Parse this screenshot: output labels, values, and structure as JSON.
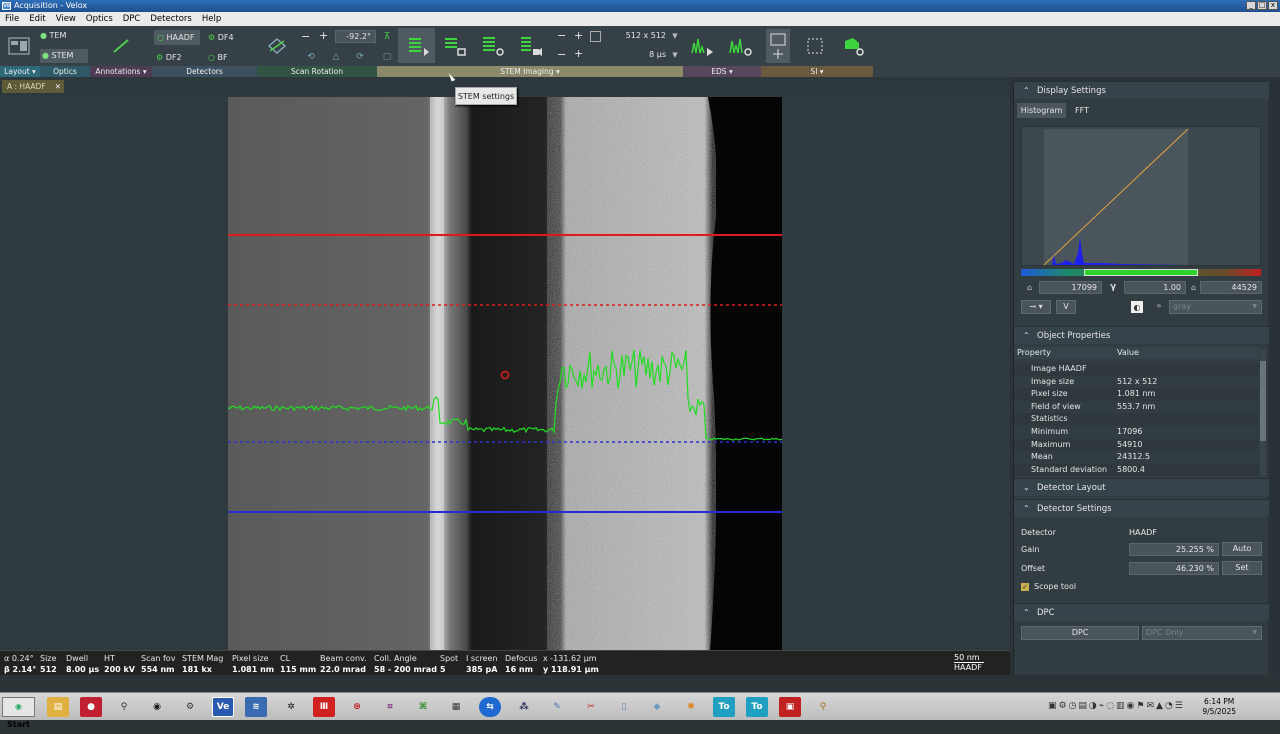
{
  "app": {
    "title": "Acquisition - Velox",
    "icon": "Ve"
  },
  "menu": [
    "File",
    "Edit",
    "View",
    "Optics",
    "DPC",
    "Detectors",
    "Help"
  ],
  "ribbon": {
    "mode_tem": "TEM",
    "mode_stem": "STEM",
    "det_haadf": "HAADF",
    "det_df4": "DF4",
    "det_df2": "DF2",
    "det_bf": "BF",
    "rotation": "-92.2°",
    "minus": "−",
    "plus": "+",
    "frame_size": "512 x 512",
    "dwell": "8 µs"
  },
  "groups": [
    "Layout ▾",
    "Optics",
    "Annotations ▾",
    "Detectors",
    "Scan Rotation",
    "STEM Imaging ▾",
    "EDS ▾",
    "SI ▾"
  ],
  "tab": {
    "label": "A : HAADF",
    "close": "✕"
  },
  "tooltip": "STEM settings",
  "image": {
    "colors": {
      "profile": "#22dd22",
      "solid_red": "#e01a1a",
      "dash_red": "#e01a1a",
      "dash_blue": "#3030d0",
      "solid_blue": "#2a2ad8"
    }
  },
  "status": [
    {
      "l": "α 0.24°",
      "v": "β 2.14°"
    },
    {
      "l": "Size",
      "v": "512"
    },
    {
      "l": "Dwell",
      "v": "8.00 µs"
    },
    {
      "l": "HT",
      "v": "200 kV"
    },
    {
      "l": "Scan fov",
      "v": "554 nm"
    },
    {
      "l": "STEM Mag",
      "v": "181 kx"
    },
    {
      "l": "Pixel size",
      "v": "1.081 nm"
    },
    {
      "l": "CL",
      "v": "115 mm"
    },
    {
      "l": "Beam conv.",
      "v": "22.0 mrad"
    },
    {
      "l": "Coll. Angle",
      "v": "58 - 200 mrad"
    },
    {
      "l": "Spot",
      "v": "5"
    },
    {
      "l": "I screen",
      "v": "385 pA"
    },
    {
      "l": "Defocus",
      "v": "16 nm"
    },
    {
      "l": "x -131.62 µm",
      "v": "y  118.91 µm"
    }
  ],
  "scalebar": {
    "value": "50 nm",
    "detector": "HAADF"
  },
  "display_settings": {
    "title": "Display Settings",
    "tab_histogram": "Histogram",
    "tab_fft": "FFT",
    "min": "17099",
    "gamma_sym": "γ",
    "gamma": "1.00",
    "max": "44529",
    "v_btn": "V",
    "palette": "gray"
  },
  "object_properties": {
    "title": "Object Properties",
    "col_property": "Property",
    "col_value": "Value",
    "rows": [
      {
        "k": "Image HAADF",
        "v": ""
      },
      {
        "k": "Image size",
        "v": "512 x 512"
      },
      {
        "k": "Pixel size",
        "v": "1.081 nm"
      },
      {
        "k": "Field of view",
        "v": "553.7 nm"
      },
      {
        "k": "Statistics",
        "v": ""
      },
      {
        "k": "Minimum",
        "v": "17096"
      },
      {
        "k": "Maximum",
        "v": "54910"
      },
      {
        "k": "Mean",
        "v": "24312.5"
      },
      {
        "k": "Standard deviation",
        "v": "5800.4"
      }
    ]
  },
  "detector_layout": {
    "title": "Detector Layout"
  },
  "detector_settings": {
    "title": "Detector Settings",
    "detector_label": "Detector",
    "detector_value": "HAADF",
    "gain_label": "Gain",
    "gain_value": "25.255 %",
    "auto": "Auto",
    "offset_label": "Offset",
    "offset_value": "46.230 %",
    "set": "Set",
    "scope_tool": "Scope tool"
  },
  "dpc": {
    "title": "DPC",
    "button": "DPC",
    "mode": "DPC Only"
  },
  "taskbar": {
    "start": "Start",
    "time": "6:14 PM",
    "date": "9/5/2025"
  }
}
